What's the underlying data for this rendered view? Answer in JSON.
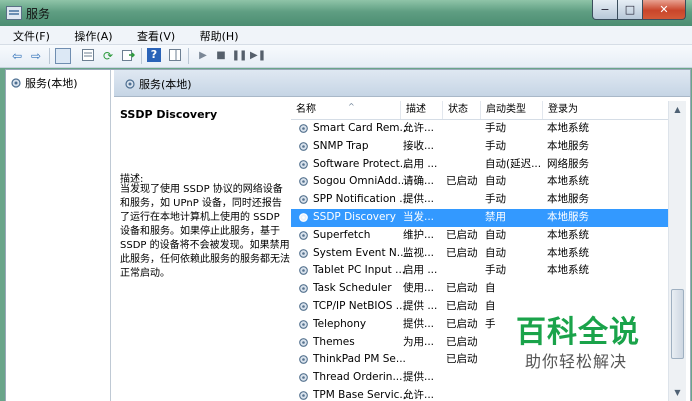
{
  "window": {
    "title": "服务",
    "min": "−",
    "max": "□",
    "close": "✕"
  },
  "menu": [
    "文件(F)",
    "操作(A)",
    "查看(V)",
    "帮助(H)"
  ],
  "toolbar_icons": [
    "back-arrow-icon",
    "forward-arrow-icon",
    "show-console-tree-icon",
    "properties-icon",
    "refresh-icon",
    "export-list-icon",
    "help-icon",
    "show-hide-action-pane-icon",
    "start-service-icon",
    "stop-service-icon",
    "pause-service-icon",
    "restart-service-icon"
  ],
  "tree": {
    "root": "服务(本地)"
  },
  "header": {
    "title": "服务(本地)"
  },
  "details": {
    "service_name": "SSDP Discovery",
    "desc_label": "描述:",
    "desc_text": "当发现了使用 SSDP 协议的网络设备和服务，如 UPnP 设备，同时还报告了运行在本地计算机上使用的 SSDP 设备和服务。如果停止此服务，基于 SSDP 的设备将不会被发现。如果禁用此服务，任何依赖此服务的服务都无法正常启动。"
  },
  "columns": [
    "名称",
    "描述",
    "状态",
    "启动类型",
    "登录为"
  ],
  "rows": [
    {
      "name": "Smart Card Rem...",
      "desc": "允许...",
      "status": "",
      "startup": "手动",
      "logon": "本地系统"
    },
    {
      "name": "SNMP Trap",
      "desc": "接收...",
      "status": "",
      "startup": "手动",
      "logon": "本地服务"
    },
    {
      "name": "Software Protect...",
      "desc": "启用 ...",
      "status": "",
      "startup": "自动(延迟...",
      "logon": "网络服务"
    },
    {
      "name": "Sogou OmniAdd...",
      "desc": "请确...",
      "status": "已启动",
      "startup": "自动",
      "logon": "本地系统"
    },
    {
      "name": "SPP Notification ...",
      "desc": "提供...",
      "status": "",
      "startup": "手动",
      "logon": "本地服务"
    },
    {
      "name": "SSDP Discovery",
      "desc": "当发...",
      "status": "",
      "startup": "禁用",
      "logon": "本地服务",
      "selected": true
    },
    {
      "name": "Superfetch",
      "desc": "维护...",
      "status": "已启动",
      "startup": "自动",
      "logon": "本地系统"
    },
    {
      "name": "System Event N...",
      "desc": "监视...",
      "status": "已启动",
      "startup": "自动",
      "logon": "本地系统"
    },
    {
      "name": "Tablet PC Input ...",
      "desc": "启用 ...",
      "status": "",
      "startup": "手动",
      "logon": "本地系统"
    },
    {
      "name": "Task Scheduler",
      "desc": "使用...",
      "status": "已启动",
      "startup": "自",
      "logon": ""
    },
    {
      "name": "TCP/IP NetBIOS ...",
      "desc": "提供 ...",
      "status": "已启动",
      "startup": "自",
      "logon": ""
    },
    {
      "name": "Telephony",
      "desc": "提供...",
      "status": "已启动",
      "startup": "手",
      "logon": ""
    },
    {
      "name": "Themes",
      "desc": "为用...",
      "status": "已启动",
      "startup": "",
      "logon": ""
    },
    {
      "name": "ThinkPad PM Se...",
      "desc": "",
      "status": "已启动",
      "startup": "",
      "logon": ""
    },
    {
      "name": "Thread Orderin...",
      "desc": "提供...",
      "status": "",
      "startup": "",
      "logon": ""
    },
    {
      "name": "TPM Base Servic...",
      "desc": "允许...",
      "status": "",
      "startup": "",
      "logon": ""
    }
  ],
  "watermark": {
    "main": "百科全说",
    "sub": "助你轻松解决"
  }
}
